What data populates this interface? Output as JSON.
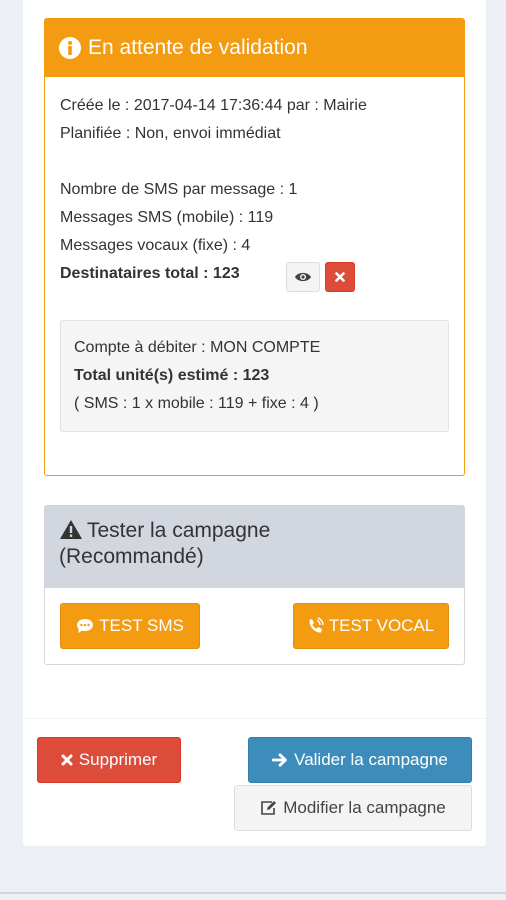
{
  "pending_box": {
    "title": "En attente de validation",
    "created": "Créée le : 2017-04-14 17:36:44 par : Mairie",
    "planned": "Planifiée : Non, envoi immédiat",
    "sms_per_message": "Nombre de SMS par message : 1",
    "sms_mobile": "Messages SMS (mobile) : 119",
    "voice_fixed": "Messages vocaux (fixe) : 4",
    "recipients_total": "Destinataires total : 123",
    "account": "Compte à débiter : MON COMPTE",
    "total_units": "Total unité(s) estimé : 123",
    "breakdown": "( SMS : 1 x mobile : 119 + fixe : 4 )"
  },
  "test_box": {
    "title_line1": "Tester la campagne",
    "title_line2": "(Recommandé)",
    "test_sms_label": "TEST SMS",
    "test_vocal_label": "TEST VOCAL"
  },
  "actions": {
    "delete_label": "Supprimer",
    "validate_label": "Valider la campagne",
    "modify_label": "Modifier la campagne"
  },
  "icons": {
    "info": "info-circle-icon",
    "view": "eye-icon",
    "remove": "close-icon",
    "warning": "warning-triangle-icon",
    "sms": "comment-dots-icon",
    "vocal": "phone-volume-icon",
    "delete": "close-icon",
    "validate": "arrow-right-icon",
    "modify": "edit-icon"
  },
  "colors": {
    "warning": "#f39c12",
    "danger": "#dd4b39",
    "primary": "#3c8dbc",
    "default": "#f4f4f4",
    "header_gray": "#d2d6de"
  }
}
